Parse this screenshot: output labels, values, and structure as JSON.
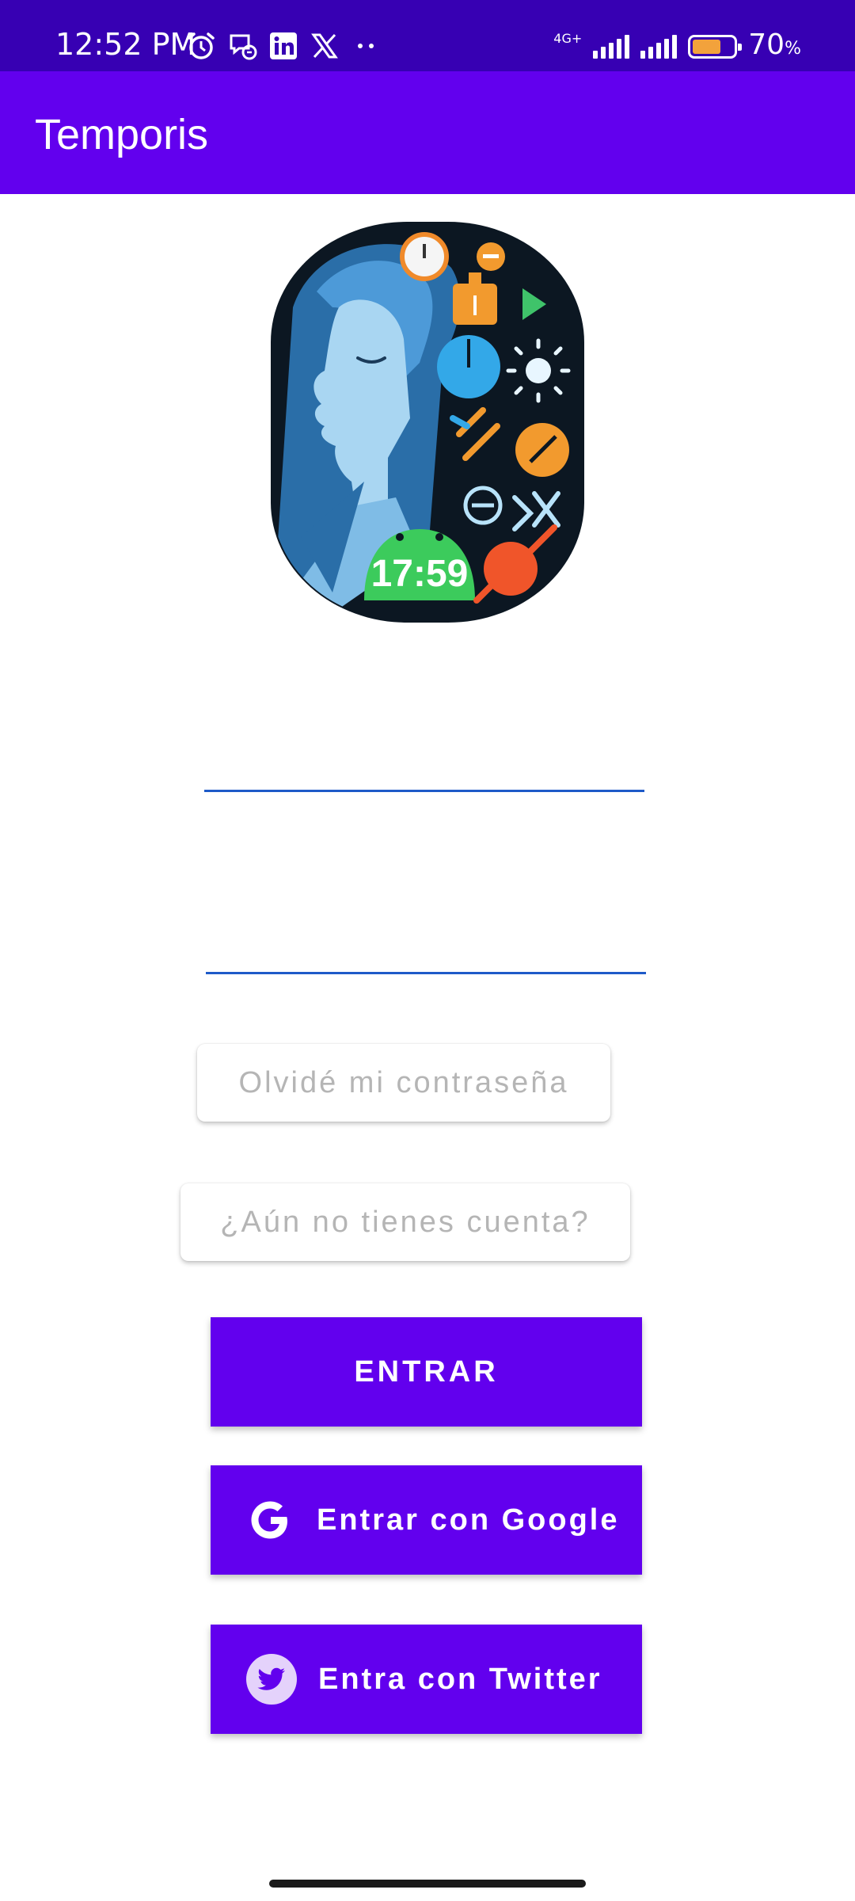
{
  "status_bar": {
    "time": "12:52 PM",
    "network_type": "4G+",
    "battery_percent": 70,
    "battery_label": "70",
    "battery_unit": "%",
    "notification_icons": [
      "alarm-icon",
      "messenger-icon",
      "linkedin-icon",
      "x-icon",
      "more-dots-icon"
    ],
    "background_color": "#3700b3"
  },
  "app_bar": {
    "title": "Temporis",
    "background_color": "#6200ee"
  },
  "logo": {
    "clock_text": "17:59"
  },
  "form": {
    "username": {
      "value": "",
      "placeholder": ""
    },
    "password": {
      "value": "",
      "placeholder": ""
    },
    "forgot_password_label": "Olvidé mi contraseña",
    "register_label": "¿Aún no tienes cuenta?"
  },
  "buttons": {
    "login_label": "ENTRAR",
    "google_label": "Entrar con Google",
    "twitter_label": "Entra con Twitter",
    "accent_color": "#6200ee"
  }
}
